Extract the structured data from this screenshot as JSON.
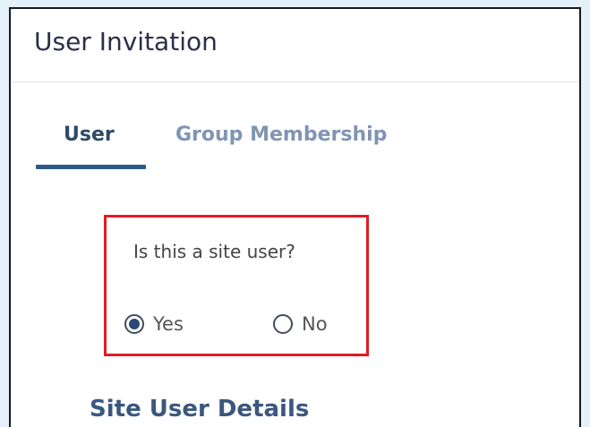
{
  "header": {
    "title": "User Invitation"
  },
  "tabs": [
    {
      "label": "User",
      "active": true
    },
    {
      "label": "Group Membership",
      "active": false
    }
  ],
  "question": {
    "text": "Is this a site user?",
    "options": [
      {
        "label": "Yes",
        "selected": true
      },
      {
        "label": "No",
        "selected": false
      }
    ]
  },
  "section": {
    "title": "Site User Details"
  },
  "colors": {
    "background": "#e4f1fb",
    "accent": "#2e5b85",
    "highlight_border": "#e01c24",
    "tab_inactive": "#8095b2"
  }
}
